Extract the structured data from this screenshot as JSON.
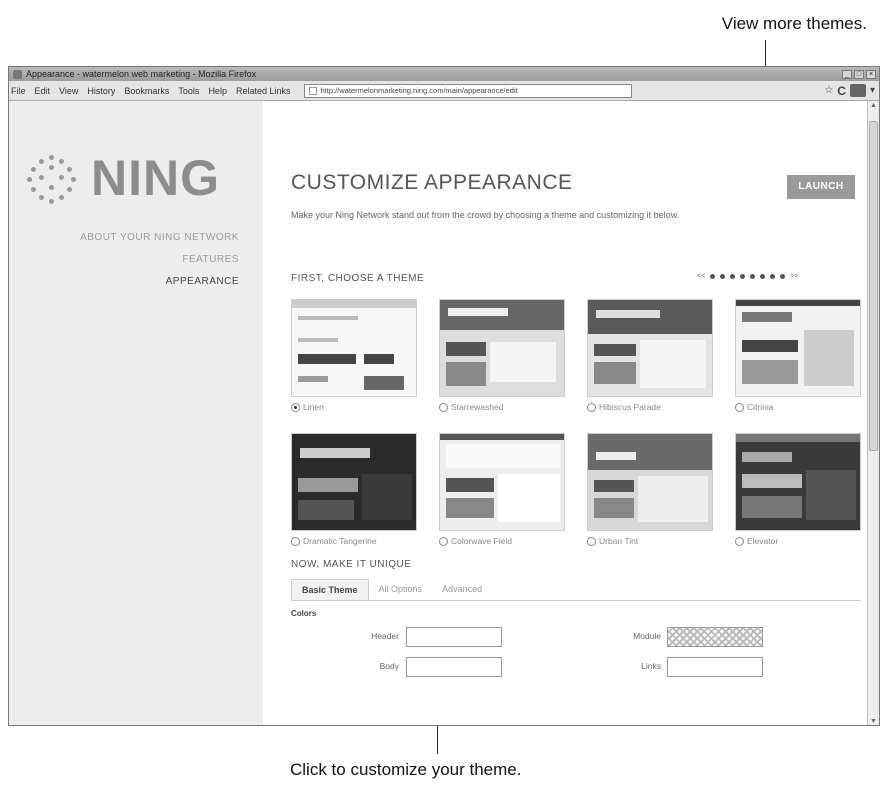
{
  "callouts": {
    "top": "View more themes.",
    "bottom": "Click to customize your theme."
  },
  "browser": {
    "window_title": "Appearance - watermelon web marketing - Mozilla Firefox",
    "menu": [
      "File",
      "Edit",
      "View",
      "History",
      "Bookmarks",
      "Tools",
      "Help",
      "Related Links"
    ],
    "url": "http://watermelonmarketing.ning.com/main/appearance/edit"
  },
  "sidebar": {
    "logo_text": "NING",
    "nav": [
      {
        "label": "ABOUT YOUR NING NETWORK",
        "active": false
      },
      {
        "label": "FEATURES",
        "active": false
      },
      {
        "label": "APPEARANCE",
        "active": true
      }
    ]
  },
  "main": {
    "title": "CUSTOMIZE APPEARANCE",
    "launch_label": "LAUNCH",
    "intro": "Make your Ning Network stand out from the crowd by choosing a theme and customizing it below.",
    "choose_theme_title": "FIRST, CHOOSE A THEME",
    "pager": {
      "prev": "<<",
      "next": ">>",
      "dot_count": 8
    },
    "themes": [
      {
        "name": "Linen",
        "selected": true
      },
      {
        "name": "Starrewashed",
        "selected": false
      },
      {
        "name": "Hibiscus Parade",
        "selected": false
      },
      {
        "name": "Citrinia",
        "selected": false
      },
      {
        "name": "Dramatic Tangerine",
        "selected": false
      },
      {
        "name": "Colorwave Field",
        "selected": false
      },
      {
        "name": "Urban Tint",
        "selected": false
      },
      {
        "name": "Elevator",
        "selected": false
      }
    ],
    "make_unique_title": "NOW, MAKE IT UNIQUE",
    "tabs": [
      {
        "label": "Basic Theme",
        "active": true
      },
      {
        "label": "All Options",
        "active": false
      },
      {
        "label": "Advanced",
        "active": false
      }
    ],
    "colors_label": "Colors",
    "color_fields": {
      "header": "Header",
      "body": "Body",
      "module": "Module",
      "links": "Links"
    }
  }
}
